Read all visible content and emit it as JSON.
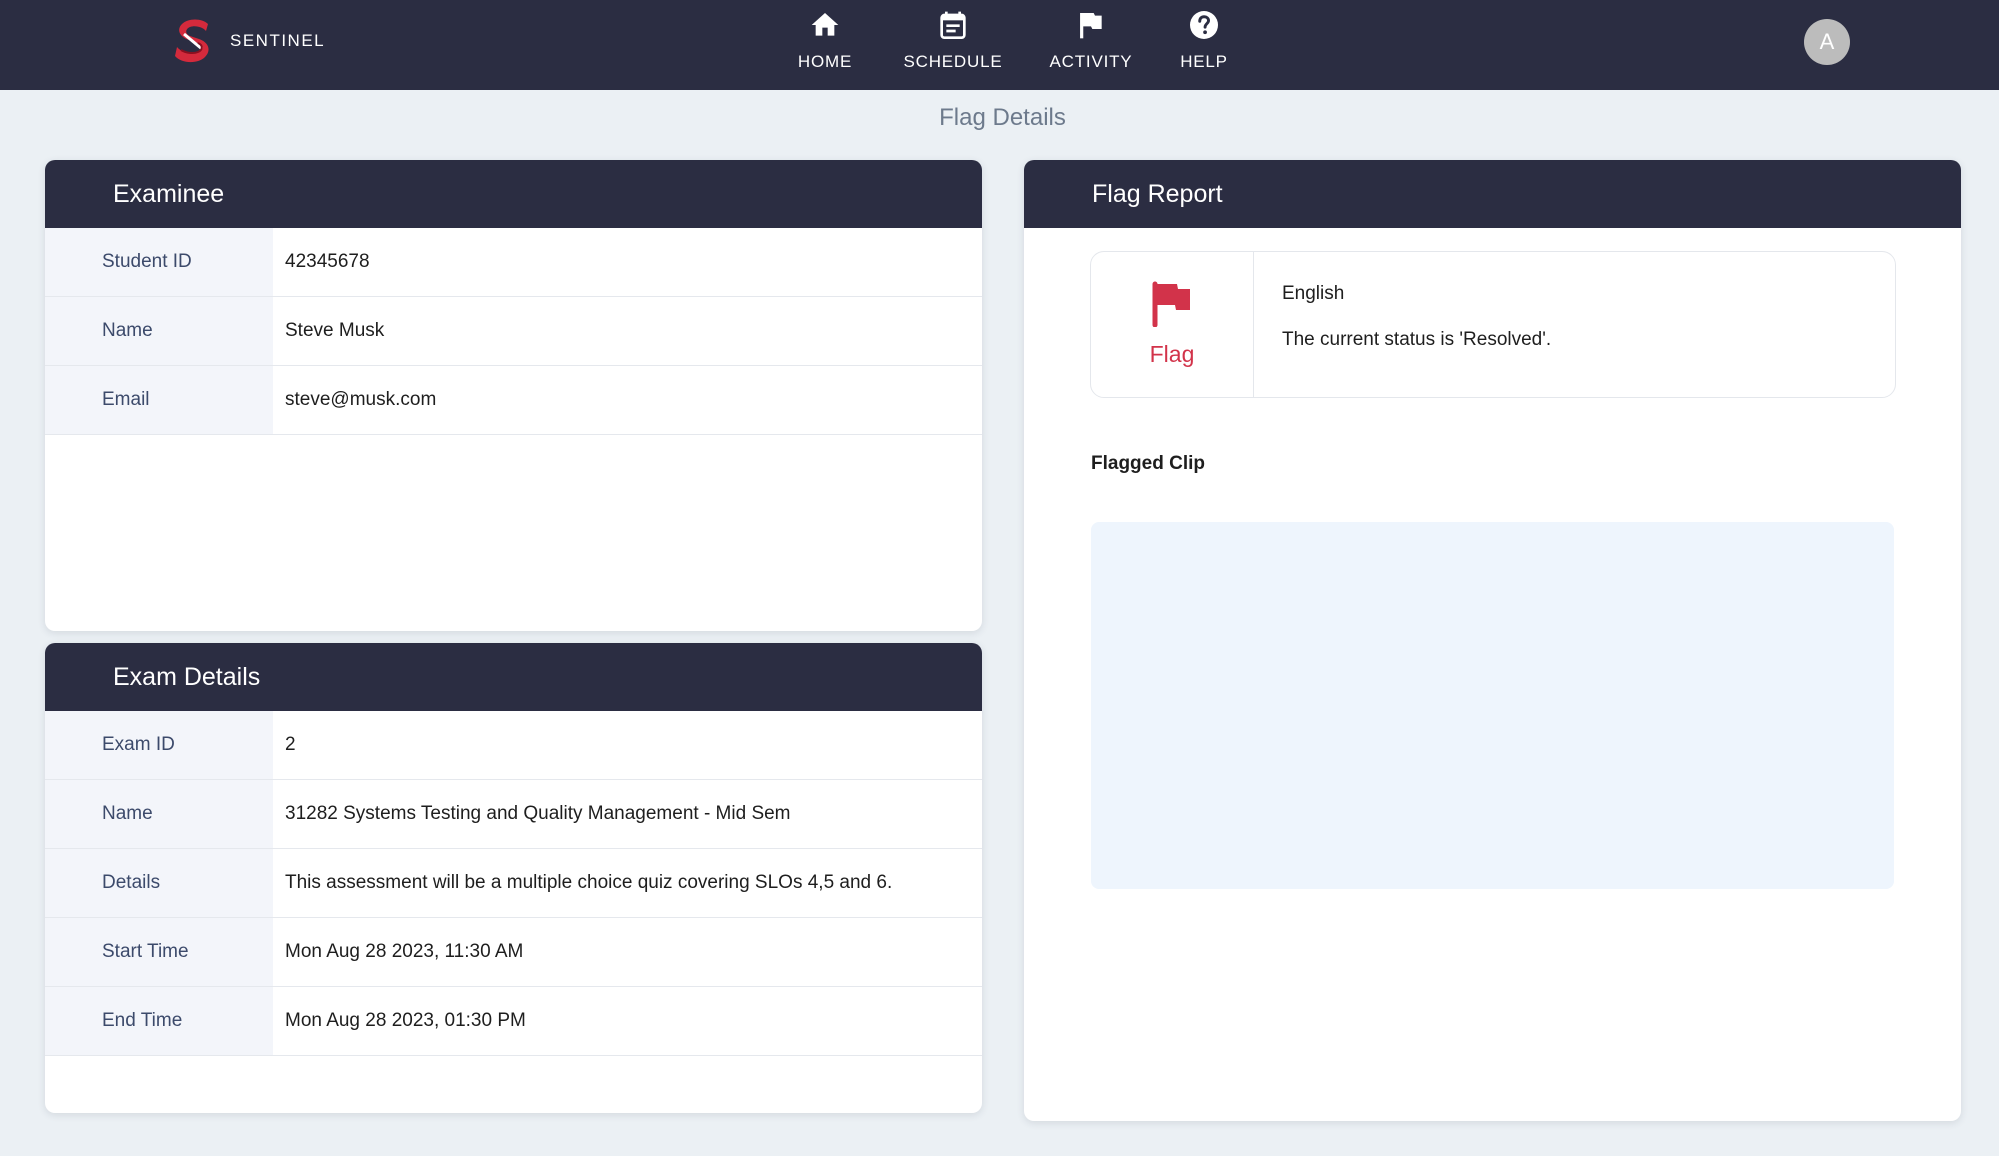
{
  "app": {
    "name": "SENTINEL"
  },
  "nav": {
    "items": [
      {
        "label": "HOME",
        "icon": "home-icon"
      },
      {
        "label": "SCHEDULE",
        "icon": "calendar-icon"
      },
      {
        "label": "ACTIVITY",
        "icon": "flag-icon"
      },
      {
        "label": "HELP",
        "icon": "help-icon"
      }
    ],
    "avatar_initial": "A"
  },
  "page": {
    "title": "Flag Details"
  },
  "examinee": {
    "header": "Examinee",
    "rows": [
      {
        "label": "Student ID",
        "value": "42345678"
      },
      {
        "label": "Name",
        "value": "Steve Musk"
      },
      {
        "label": "Email",
        "value": "steve@musk.com"
      }
    ]
  },
  "exam": {
    "header": "Exam Details",
    "rows": [
      {
        "label": "Exam ID",
        "value": "2"
      },
      {
        "label": "Name",
        "value": "31282 Systems Testing and Quality Management - Mid Sem"
      },
      {
        "label": "Details",
        "value": "This assessment will be a multiple choice quiz covering SLOs 4,5 and 6."
      },
      {
        "label": "Start Time",
        "value": "Mon Aug 28 2023, 11:30 AM"
      },
      {
        "label": "End Time",
        "value": "Mon Aug 28 2023, 01:30 PM"
      }
    ]
  },
  "flag_report": {
    "header": "Flag Report",
    "flag_label": "Flag",
    "language": "English",
    "status_text": "The current status is 'Resolved'.",
    "clip_label": "Flagged Clip"
  },
  "colors": {
    "navbar": "#2b2d42",
    "page_background": "#ebf0f4",
    "flag_red": "#d2334a",
    "clip_background": "#eef5fd",
    "key_cell_background": "#f3f5fa"
  }
}
